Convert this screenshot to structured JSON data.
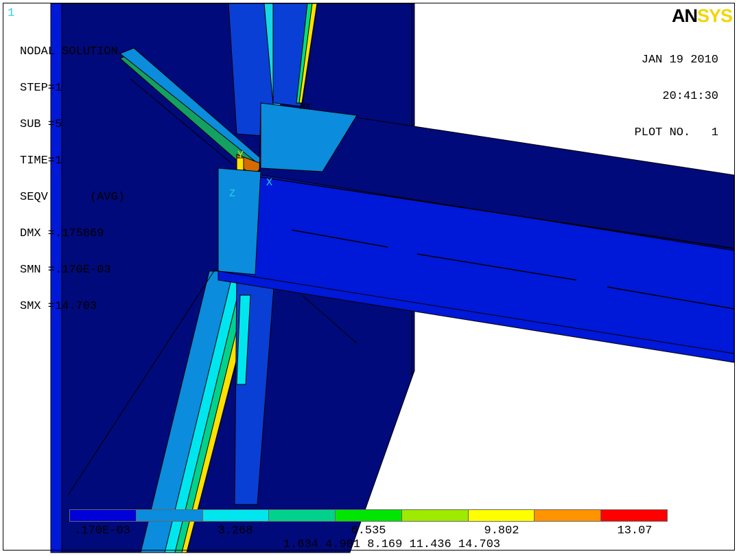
{
  "window_number": "1",
  "info": {
    "line1": "NODAL SOLUTION",
    "line2": "STEP=1",
    "line3": "SUB =5",
    "line4": "TIME=1",
    "line5": "SEQV      (AVG)",
    "line6": "DMX =.175869",
    "line7": "SMN =.170E-03",
    "line8": "SMX =14.703"
  },
  "logo": {
    "part1": "AN",
    "part2": "SYS"
  },
  "date": {
    "date": "JAN 19 2010",
    "time": "20:41:30",
    "plot": "PLOT NO.   1"
  },
  "axes": {
    "x": "X",
    "y": "Y",
    "z": "Z",
    "mx": "MX"
  },
  "legend": {
    "colors": [
      "#0000d8",
      "#0b8cdc",
      "#00e6ee",
      "#00d28c",
      "#00e600",
      "#9eea00",
      "#ffff00",
      "#ff9300",
      "#ff0000"
    ],
    "upper_labels": [
      ".170E-03",
      "3.268",
      "6.535",
      "9.802",
      "13.07"
    ],
    "lower_labels": "1.634 4.901 8.169 11.436 14.703"
  }
}
